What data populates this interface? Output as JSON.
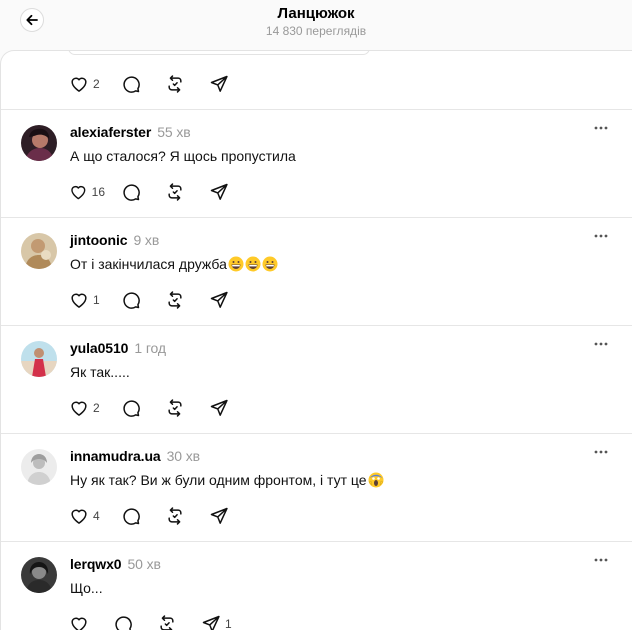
{
  "header": {
    "title": "Ланцюжок",
    "views": "14 830 переглядів"
  },
  "top_actions": {
    "likes": "2"
  },
  "posts": [
    {
      "username": "alexiaferster",
      "time": "55 хв",
      "text": "А що сталося? Я щось пропустила",
      "likes": "16",
      "shares": ""
    },
    {
      "username": "jintoonic",
      "time": "9 хв",
      "text": "От і закінчилася дружба",
      "emoji": [
        "grinning-face-emoji",
        "grinning-face-emoji",
        "grinning-face-emoji"
      ],
      "likes": "1",
      "shares": ""
    },
    {
      "username": "yula0510",
      "time": "1 год",
      "text": "Як так.....",
      "likes": "2",
      "shares": ""
    },
    {
      "username": "innamudra.ua",
      "time": "30 хв",
      "text": "Ну як так? Ви ж були одним фронтом, і тут це",
      "emoji": [
        "screaming-face-emoji"
      ],
      "likes": "4",
      "shares": ""
    },
    {
      "username": "lerqwx0",
      "time": "50 хв",
      "text": "Що...",
      "likes": "",
      "shares": "1"
    }
  ],
  "colors": {
    "background": "#fafafa",
    "panel": "#ffffff",
    "muted": "#999999",
    "divider": "#e6e6e6"
  }
}
